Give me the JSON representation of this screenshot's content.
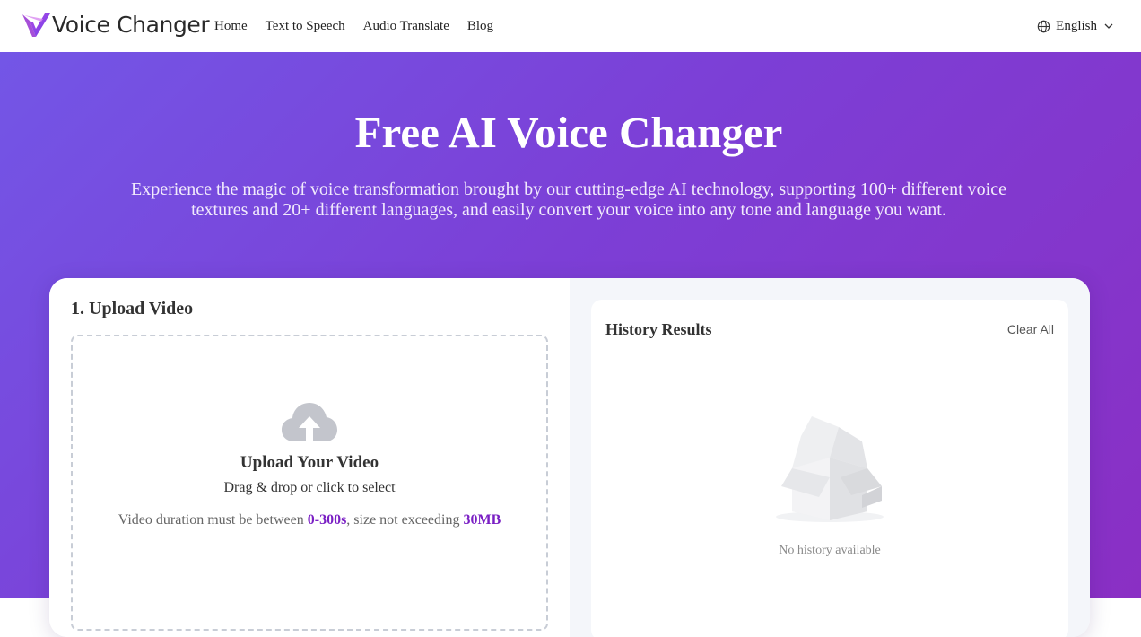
{
  "header": {
    "logo_text": "Voice Changer",
    "nav": [
      {
        "label": "Home"
      },
      {
        "label": "Text to Speech"
      },
      {
        "label": "Audio Translate"
      },
      {
        "label": "Blog"
      }
    ],
    "language": "English"
  },
  "hero": {
    "title": "Free AI Voice Changer",
    "subtitle": "Experience the magic of voice transformation brought by our cutting-edge AI technology, supporting 100+ different voice textures and 20+ different languages, and easily convert your voice into any tone and language you want."
  },
  "upload": {
    "section_title": "1. Upload Video",
    "title": "Upload Your Video",
    "hint": "Drag & drop or click to select",
    "limit_prefix": "Video duration must be between ",
    "duration_range": "0-300s",
    "limit_middle": ", size not exceeding ",
    "max_size": "30MB"
  },
  "history": {
    "title": "History Results",
    "clear_label": "Clear All",
    "empty_text": "No history available"
  },
  "colors": {
    "accent": "#7a1fc4",
    "hero_gradient_start": "#7356e6",
    "hero_gradient_end": "#8a2fc4"
  },
  "icons": {
    "logo": "v-logo-icon",
    "language": "globe-icon",
    "dropdown": "chevron-down-icon",
    "upload": "cloud-upload-icon",
    "empty": "empty-box-icon"
  }
}
